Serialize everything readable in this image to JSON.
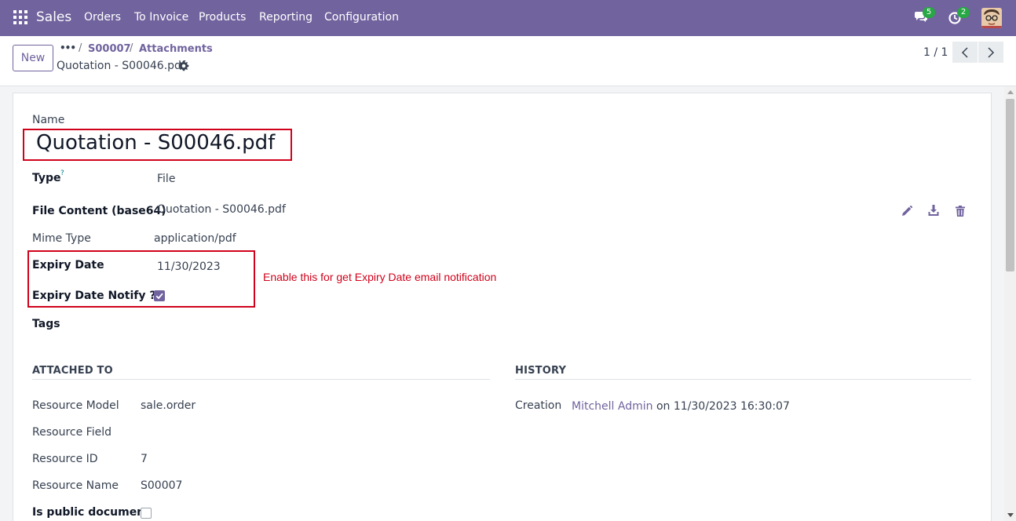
{
  "navbar": {
    "app_name": "Sales",
    "menu": [
      "Orders",
      "To Invoice",
      "Products",
      "Reporting",
      "Configuration"
    ],
    "messages_count": "5",
    "activities_count": "2",
    "badge_color": "#28a745",
    "bar_color": "#71639e"
  },
  "control_panel": {
    "new_label": "New",
    "breadcrumb_more": "•••",
    "breadcrumb": [
      "S00007",
      "Attachments"
    ],
    "record_title": "Quotation - S00046.pdf",
    "pager_value": "1 / 1"
  },
  "form": {
    "name_label": "Name",
    "name_value": "Quotation - S00046.pdf",
    "type_label": "Type",
    "type_help": "?",
    "type_value": "File",
    "file_content_label": "File Content (base64)",
    "file_content_value": "Quotation - S00046.pdf",
    "mime_label": "Mime Type",
    "mime_value": "application/pdf",
    "expiry_label": "Expiry Date",
    "expiry_value": "11/30/2023",
    "expiry_notify_label": "Expiry Date Notify ??",
    "expiry_notify_checked": true,
    "tags_label": "Tags",
    "annotation": "Enable this for get Expiry Date email notification",
    "annotation_color": "#d0021b"
  },
  "attached_to": {
    "title": "ATTACHED TO",
    "rows": [
      {
        "label": "Resource Model",
        "value": "sale.order"
      },
      {
        "label": "Resource Field",
        "value": ""
      },
      {
        "label": "Resource ID",
        "value": "7"
      },
      {
        "label": "Resource Name",
        "value": "S00007"
      }
    ],
    "public_label": "Is public document",
    "public_checked": false
  },
  "history": {
    "title": "HISTORY",
    "creation_label": "Creation",
    "creation_user": "Mitchell Admin",
    "creation_suffix": "on 11/30/2023 16:30:07"
  }
}
